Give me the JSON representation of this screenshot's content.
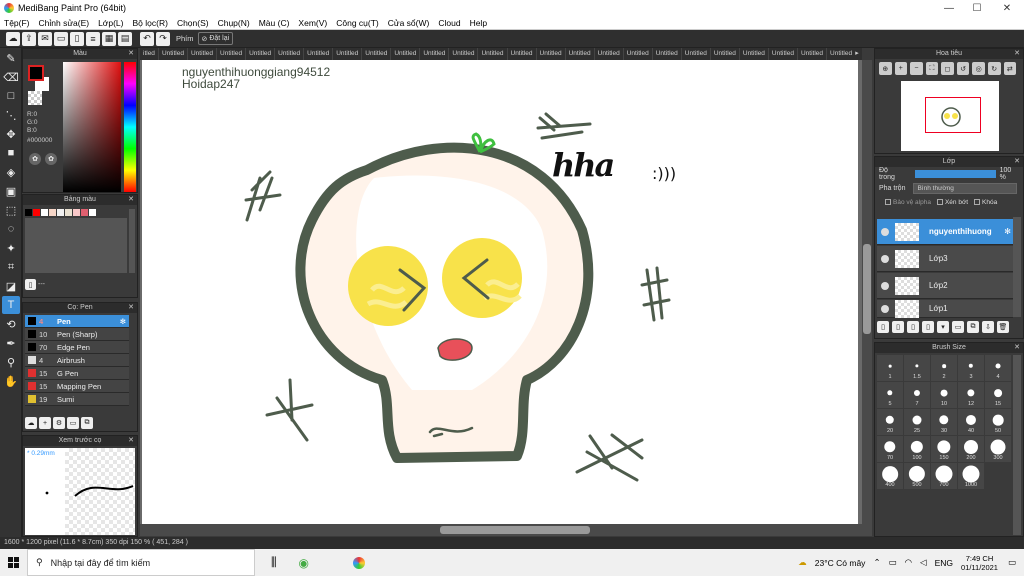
{
  "window": {
    "title": "MediBang Paint Pro (64bit)",
    "min": "—",
    "max": "☐",
    "close": "✕"
  },
  "menu": [
    "Tệp(F)",
    "Chỉnh sửa(E)",
    "Lớp(L)",
    "Bộ lọc(R)",
    "Chọn(S)",
    "Chụp(N)",
    "Màu (C)",
    "Xem(V)",
    "Công cụ(T)",
    "Cửa sổ(W)",
    "Cloud",
    "Help"
  ],
  "toolbar": {
    "key_label": "Phím",
    "reset_label": "Đặt lại"
  },
  "color_panel": {
    "title": "Màu",
    "r": "R:0",
    "g": "G:0",
    "b": "B:0",
    "hex": "#000000"
  },
  "palette_panel": {
    "title": "Bảng màu",
    "colors": [
      "#000000",
      "#ff0000",
      "#ffffff",
      "#f6d6c8",
      "#f0f0f0",
      "#e8e0d0",
      "#f8c8c8",
      "#e06070",
      "#ffffff"
    ],
    "footer_label": "---"
  },
  "brush_panel": {
    "title": "Cọ: Pen",
    "brushes": [
      {
        "size": "4",
        "name": "Pen",
        "color": "#000000",
        "selected": true
      },
      {
        "size": "10",
        "name": "Pen (Sharp)",
        "color": "#000000"
      },
      {
        "size": "70",
        "name": "Edge Pen",
        "color": "#000000"
      },
      {
        "size": "4",
        "name": "Airbrush",
        "color": "#dddddd"
      },
      {
        "size": "15",
        "name": "G Pen",
        "color": "#e03030"
      },
      {
        "size": "15",
        "name": "Mapping Pen",
        "color": "#e03030"
      },
      {
        "size": "19",
        "name": "Sumi",
        "color": "#e0c030"
      }
    ]
  },
  "preview_panel": {
    "title": "Xem trước cọ",
    "size": "* 0.29mm"
  },
  "tabs": [
    "itled",
    "Untitled",
    "Untitled",
    "Untitled",
    "Untitled",
    "Untitled",
    "Untitled",
    "Untitled",
    "Untitled",
    "Untitled",
    "Untitled",
    "Untitled",
    "Untitled",
    "Untitled",
    "Untitled",
    "Untitled",
    "Untitled",
    "Untitled",
    "Untitled",
    "Untitled",
    "Untitled",
    "Untitled",
    "Untitled",
    "Untitled",
    "Untitled",
    "Untitled",
    "Untitled",
    "Untitled",
    "Untitled",
    "Untitled",
    "Untitled",
    "Untitled",
    "Untitled"
  ],
  "canvas": {
    "text_line1": "nguyenthihuonggiang94512",
    "text_line2": "Hoidap247",
    "hha": "hha",
    "hha_marks": ":)))"
  },
  "nav_panel": {
    "title": "Hoa tiêu"
  },
  "layer_panel": {
    "title": "Lớp",
    "opacity_label": "Độ trong",
    "opacity_value": "100 %",
    "opacity": 100,
    "blend_label": "Pha trộn",
    "blend_value": "Bình thường",
    "protect_alpha": "Bảo vệ alpha",
    "clip": "Xén bớt",
    "lock": "Khóa",
    "layers": [
      "nguyenthihuong",
      "Lớp3",
      "Lớp2",
      "Lớp1"
    ]
  },
  "brush_size_panel": {
    "title": "Brush Size",
    "sizes": [
      "1",
      "1.5",
      "2",
      "3",
      "4",
      "5",
      "7",
      "10",
      "12",
      "15",
      "20",
      "25",
      "30",
      "40",
      "50",
      "70",
      "100",
      "150",
      "200",
      "300",
      "400",
      "500",
      "700",
      "1000"
    ]
  },
  "status": {
    "text": "1600 * 1200 pixel   (11.6 * 8.7cm)   350 dpi   150 %   ( 451, 284 )"
  },
  "taskbar": {
    "search_placeholder": "Nhập tại đây để tìm kiếm",
    "weather": "23°C  Có mây",
    "lang": "ENG",
    "time": "7:49 CH",
    "date": "01/11/2021"
  },
  "colors": {
    "accent": "#3b8fd9",
    "skull_outline": "#4e5c4c",
    "eye_yellow": "#f8e24a",
    "mouth": "#e8505a",
    "sprout": "#3fbf3f"
  }
}
